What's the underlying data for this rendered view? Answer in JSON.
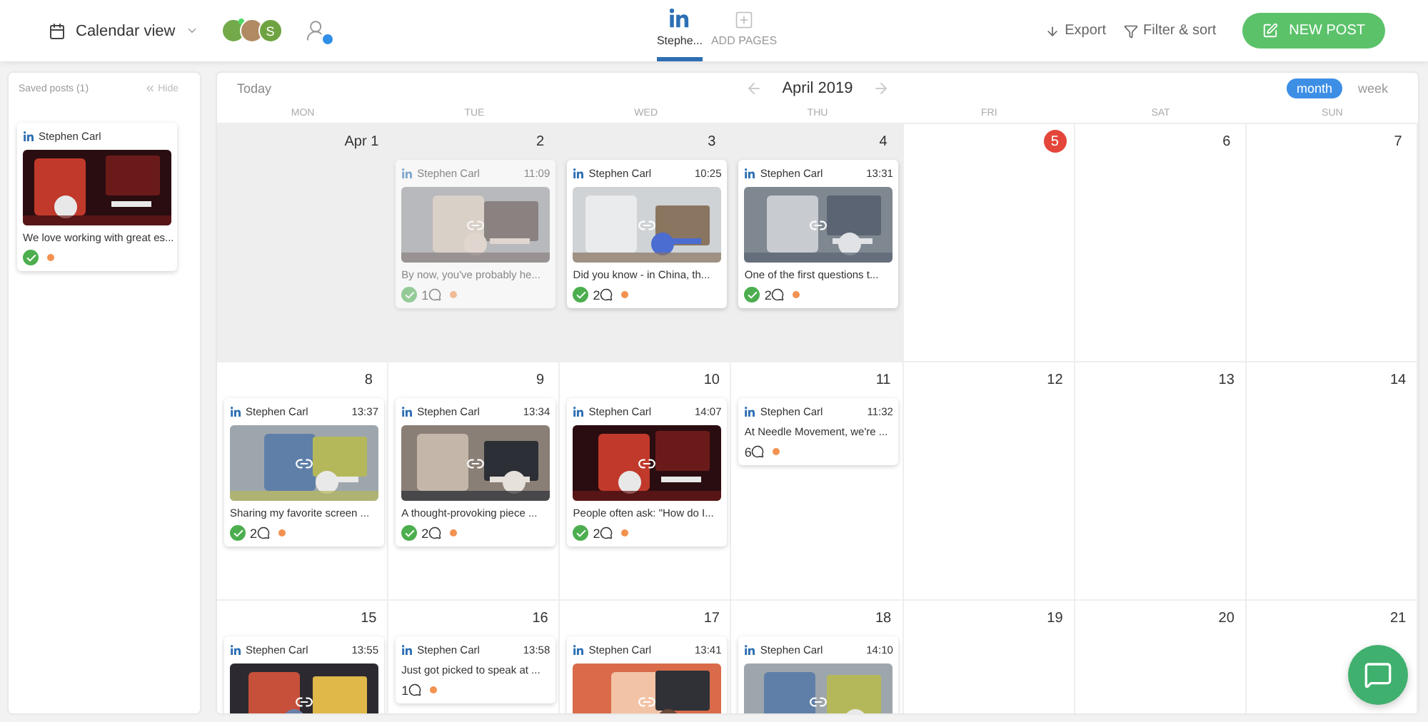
{
  "toolbar": {
    "view": "Calendar view",
    "avatars": [
      {
        "kind": "picture",
        "online": true
      },
      {
        "kind": "picture"
      },
      {
        "kind": "letter",
        "text": "S"
      }
    ]
  },
  "pages": [
    {
      "kind": "linkedin",
      "label": "Stephe...",
      "selected": true
    },
    {
      "kind": "add",
      "label": "ADD PAGES",
      "selected": false
    }
  ],
  "actions": {
    "export": "Export",
    "filter": "Filter & sort",
    "new_post": "NEW POST"
  },
  "saved": {
    "title": "Saved posts (1)",
    "hide": "Hide",
    "posts": [
      {
        "author": "Stephen Carl",
        "caption": "We love working with great es...",
        "approved": true,
        "status_dot": true
      }
    ]
  },
  "calendar": {
    "today": "Today",
    "month": "April 2019",
    "views": [
      {
        "label": "month",
        "selected": true
      },
      {
        "label": "week",
        "selected": false
      }
    ],
    "weekdays": [
      "MON",
      "TUE",
      "WED",
      "THU",
      "FRI",
      "SAT",
      "SUN"
    ],
    "weeks": [
      [
        {
          "label": "Apr 1",
          "past": true
        },
        {
          "label": "2",
          "past": true,
          "posts": [
            {
              "author": "Stephen Carl",
              "time": "11:09",
              "caption": "By now, you've probably he...",
              "approved": true,
              "comments": "1",
              "status_dot": true,
              "dimmed": true
            }
          ]
        },
        {
          "label": "3",
          "past": true,
          "posts": [
            {
              "author": "Stephen Carl",
              "time": "10:25",
              "caption": "Did you know - in China, th...",
              "approved": true,
              "comments": "2",
              "status_dot": true
            }
          ]
        },
        {
          "label": "4",
          "past": true,
          "posts": [
            {
              "author": "Stephen Carl",
              "time": "13:31",
              "caption": "One of the first questions t...",
              "approved": true,
              "comments": "2",
              "status_dot": true
            }
          ]
        },
        {
          "label": "5",
          "today": true
        },
        {
          "label": "6"
        },
        {
          "label": "7"
        }
      ],
      [
        {
          "label": "8",
          "posts": [
            {
              "author": "Stephen Carl",
              "time": "13:37",
              "caption": "Sharing my favorite screen ...",
              "approved": true,
              "comments": "2",
              "status_dot": true
            }
          ]
        },
        {
          "label": "9",
          "posts": [
            {
              "author": "Stephen Carl",
              "time": "13:34",
              "caption": "A thought-provoking piece ...",
              "approved": true,
              "comments": "2",
              "status_dot": true
            }
          ]
        },
        {
          "label": "10",
          "posts": [
            {
              "author": "Stephen Carl",
              "time": "14:07",
              "caption": "People often ask: \"How do I...",
              "approved": true,
              "comments": "2",
              "status_dot": true
            }
          ]
        },
        {
          "label": "11",
          "posts": [
            {
              "author": "Stephen Carl",
              "time": "11:32",
              "kind": "text",
              "caption": "At Needle Movement, we're ...",
              "comments": "6",
              "status_dot": true
            }
          ]
        },
        {
          "label": "12"
        },
        {
          "label": "13"
        },
        {
          "label": "14"
        }
      ],
      [
        {
          "label": "15",
          "posts": [
            {
              "author": "Stephen Carl",
              "time": "13:55"
            }
          ]
        },
        {
          "label": "16",
          "posts": [
            {
              "author": "Stephen Carl",
              "time": "13:58",
              "kind": "text",
              "caption": "Just got picked to speak at ...",
              "comments": "1",
              "status_dot": true
            }
          ]
        },
        {
          "label": "17",
          "posts": [
            {
              "author": "Stephen Carl",
              "time": "13:41"
            }
          ]
        },
        {
          "label": "18",
          "posts": [
            {
              "author": "Stephen Carl",
              "time": "14:10"
            }
          ]
        },
        {
          "label": "19"
        },
        {
          "label": "20"
        },
        {
          "label": "21"
        }
      ]
    ]
  }
}
